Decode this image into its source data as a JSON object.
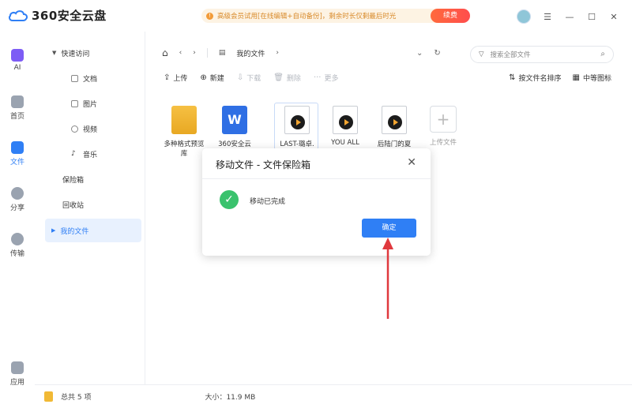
{
  "app": {
    "title": "360安全云盘"
  },
  "promo": {
    "text": "高级会员试用[在线编辑+自动备份]，剩余时长仅剩最后时光",
    "renew_label": "续费"
  },
  "colors": {
    "accent": "#2f7ff5",
    "success": "#3ac26d",
    "annotation": "#e0393e"
  },
  "rail": [
    {
      "label": "AI",
      "icon": "ai-icon"
    },
    {
      "label": "首页",
      "icon": "home-icon"
    },
    {
      "label": "文件",
      "icon": "file-icon"
    },
    {
      "label": "分享",
      "icon": "share-icon"
    },
    {
      "label": "传输",
      "icon": "transfer-icon"
    },
    {
      "label": "应用",
      "icon": "apps-icon"
    }
  ],
  "sidebar": {
    "quick_access": "快速访问",
    "sub": [
      "文档",
      "图片",
      "视频",
      "音乐"
    ],
    "vault": "保险箱",
    "recycle": "回收站",
    "my_files": "我的文件"
  },
  "breadcrumb": {
    "current": "我的文件"
  },
  "search": {
    "placeholder": "搜索全部文件"
  },
  "toolbar": {
    "upload": "上传",
    "new": "新建",
    "download": "下载",
    "delete": "删除",
    "more": "更多",
    "sort": "按文件名排序",
    "view": "中等图标"
  },
  "files": [
    {
      "name": "多种格式预览库",
      "type": "folder"
    },
    {
      "name": "360安全云",
      "type": "wps"
    },
    {
      "name": "LAST-璐卓.",
      "type": "video"
    },
    {
      "name": "YOU ALL",
      "type": "video"
    },
    {
      "name": "后陆门的夏",
      "type": "video"
    },
    {
      "name": "上传文件",
      "type": "upload"
    }
  ],
  "status": {
    "count": "总共 5 项",
    "size": "大小：11.9 MB"
  },
  "modal": {
    "title": "移动文件 - 文件保险箱",
    "message": "移动已完成",
    "confirm": "确定"
  }
}
